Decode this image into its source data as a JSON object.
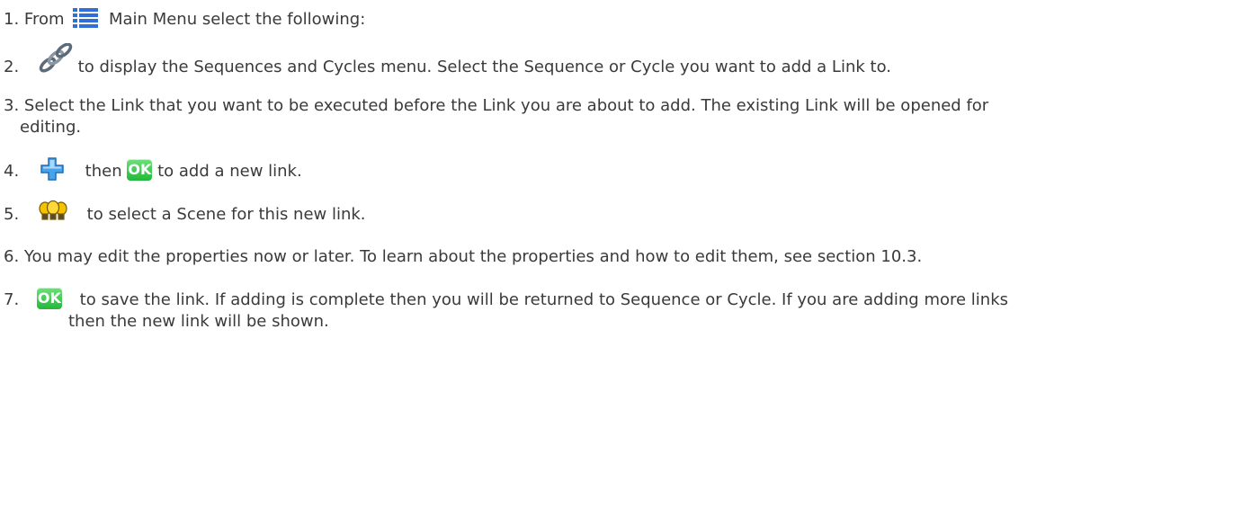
{
  "steps": [
    {
      "num": "1.",
      "pre": "From",
      "post": "Main Menu select the following:"
    },
    {
      "num": "2.",
      "text": "to display the Sequences and Cycles menu. Select the Sequence or Cycle you want to add a Link to."
    },
    {
      "num": "3.",
      "text": "Select the Link that you want to be executed before the Link you are about to add. The existing Link will be opened for",
      "cont": "editing."
    },
    {
      "num": "4.",
      "mid": "then",
      "text": "to add a new link."
    },
    {
      "num": "5.",
      "text": "to select a Scene for this new link."
    },
    {
      "num": "6.",
      "text": "You may edit the properties now or later. To learn about the properties and how to edit them, see section 10.3."
    },
    {
      "num": "7.",
      "text": "to save the link. If adding is complete then you will be returned to Sequence or Cycle. If you are adding more links",
      "cont": "then the new link will be shown."
    }
  ],
  "ok_label": "OK",
  "icons": {
    "main_menu": "list-menu-icon",
    "sequences": "chain-link-icon",
    "add": "plus-icon",
    "scene": "light-bulbs-icon"
  },
  "colors": {
    "text": "#3a3a3a",
    "ok_green": "#22b83a",
    "menu_blue": "#2f6fd6",
    "plus_blue": "#4aa3e8",
    "bulb_yellow": "#f2c300"
  }
}
